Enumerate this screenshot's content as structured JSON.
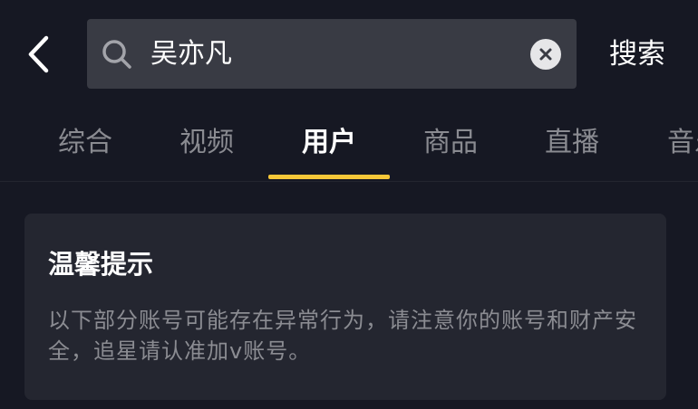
{
  "header": {
    "back_icon": "chevron-left-icon",
    "search_icon": "search-icon",
    "query": "吴亦凡",
    "clear_icon": "close-icon",
    "search_label": "搜索"
  },
  "tabs": [
    {
      "label": "综合",
      "active": false
    },
    {
      "label": "视频",
      "active": false
    },
    {
      "label": "用户",
      "active": true
    },
    {
      "label": "商品",
      "active": false
    },
    {
      "label": "直播",
      "active": false
    },
    {
      "label": "音乐",
      "active": false
    }
  ],
  "notice": {
    "title": "温馨提示",
    "body": "以下部分账号可能存在异常行为，请注意你的账号和财产安全，追星请认准加v账号。"
  },
  "colors": {
    "background": "#161823",
    "search_box": "#393b44",
    "accent": "#f6c738",
    "card": "#242630",
    "inactive_text": "#8a8b91"
  }
}
